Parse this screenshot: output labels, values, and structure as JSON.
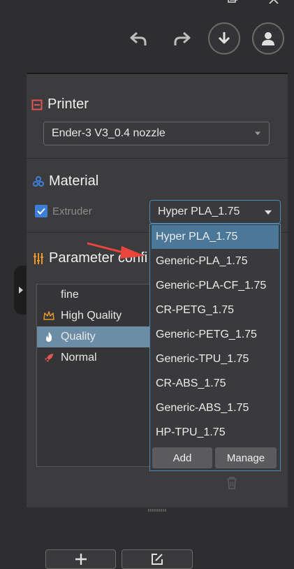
{
  "toolbar": {
    "undo_icon": "undo-icon",
    "redo_icon": "redo-icon",
    "download_icon": "download-icon",
    "user_icon": "user-icon"
  },
  "printer": {
    "title": "Printer",
    "selected": "Ender-3 V3_0.4 nozzle",
    "accent_color": "#e05555"
  },
  "material": {
    "title": "Material",
    "extruder_label": "Extruder",
    "extruder_checked": true,
    "selected": "Hyper PLA_1.75",
    "accent_color": "#3d7fd6"
  },
  "parameter": {
    "title": "Parameter confi",
    "items": [
      {
        "label": "fine",
        "icon": ""
      },
      {
        "label": "High Quality",
        "icon": "crown-icon"
      },
      {
        "label": "Quality",
        "icon": "flame-icon"
      },
      {
        "label": "Normal",
        "icon": "rocket-icon"
      }
    ],
    "selected_index": 2
  },
  "material_dropdown": {
    "options": [
      "Hyper PLA_1.75",
      "Generic-PLA_1.75",
      "Generic-PLA-CF_1.75",
      "CR-PETG_1.75",
      "Generic-PETG_1.75",
      "Generic-TPU_1.75",
      "CR-ABS_1.75",
      "Generic-ABS_1.75",
      "HP-TPU_1.75"
    ],
    "selected_index": 0,
    "add_label": "Add",
    "manage_label": "Manage"
  },
  "colors": {
    "selection": "#4b7898",
    "dropdown_border": "#4d88b6",
    "annotation_arrow": "#e8453c"
  }
}
